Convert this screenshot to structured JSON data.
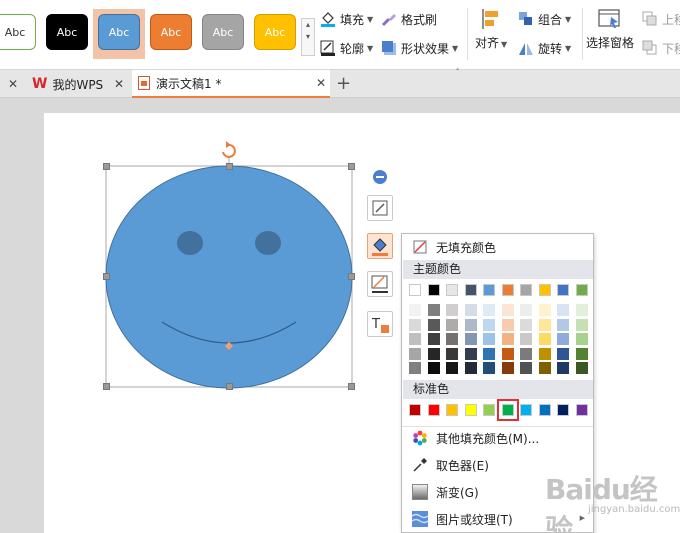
{
  "colors": {
    "shape_fill": "#5b9bd5",
    "shape_stroke": "#41719c",
    "accent": "#f07c3a",
    "highlight": "#e03030"
  },
  "ribbon": {
    "styles": [
      {
        "label": "Abc",
        "bg": "#ffffff",
        "fg": "#333333",
        "border": "#70ad47"
      },
      {
        "label": "Abc",
        "bg": "#000000",
        "fg": "#ffffff",
        "border": "#000000"
      },
      {
        "label": "Abc",
        "bg": "#5b9bd5",
        "fg": "#ffffff",
        "border": "#41719c"
      },
      {
        "label": "Abc",
        "bg": "#ed7d31",
        "fg": "#ffffff",
        "border": "#c05a18"
      },
      {
        "label": "Abc",
        "bg": "#a5a5a5",
        "fg": "#ffffff",
        "border": "#848484"
      },
      {
        "label": "Abc",
        "bg": "#ffc000",
        "fg": "#ffffff",
        "border": "#d49e00"
      }
    ],
    "fill": "填充",
    "format_brush": "格式刷",
    "outline": "轮廓",
    "shape_effects": "形状效果",
    "align": "对齐",
    "group": "组合",
    "rotate": "旋转",
    "selection_pane": "选择窗格",
    "move_up": "上移",
    "move_down": "下移"
  },
  "tabs": [
    {
      "label": "我的WPS",
      "logo": "W"
    },
    {
      "label": "演示文稿1 *"
    }
  ],
  "fill_menu": {
    "no_fill": "无填充颜色",
    "theme_colors_header": "主题颜色",
    "theme_colors": [
      "#ffffff",
      "#000000",
      "#e7e6e6",
      "#44546a",
      "#5b9bd5",
      "#ed7d31",
      "#a5a5a5",
      "#ffc000",
      "#4472c4",
      "#70ad47"
    ],
    "theme_tints": [
      [
        "#f2f2f2",
        "#7f7f7f",
        "#d0cece",
        "#d6dce5",
        "#deebf7",
        "#fbe5d6",
        "#ededed",
        "#fff2cc",
        "#dae3f3",
        "#e2f0d9"
      ],
      [
        "#d9d9d9",
        "#595959",
        "#aeabab",
        "#adb9ca",
        "#bdd7ee",
        "#f8cbad",
        "#dbdbdb",
        "#ffe699",
        "#b4c7e7",
        "#c5e0b4"
      ],
      [
        "#bfbfbf",
        "#404040",
        "#757171",
        "#8497b0",
        "#9dc3e6",
        "#f4b183",
        "#c9c9c9",
        "#ffd966",
        "#8faadc",
        "#a9d18e"
      ],
      [
        "#a6a6a6",
        "#262626",
        "#3b3838",
        "#333f50",
        "#2e75b6",
        "#c55a11",
        "#7b7b7b",
        "#bf9000",
        "#2f5597",
        "#548235"
      ],
      [
        "#808080",
        "#0d0d0d",
        "#171616",
        "#222a35",
        "#1f4e79",
        "#843c0c",
        "#525252",
        "#7f6000",
        "#203864",
        "#385723"
      ]
    ],
    "standard_header": "标准色",
    "standard_colors": [
      "#c00000",
      "#ff0000",
      "#ffc000",
      "#ffff00",
      "#92d050",
      "#00b050",
      "#00b0f0",
      "#0070c0",
      "#002060",
      "#7030a0"
    ],
    "selected_standard_index": 5,
    "more_colors": "其他填充颜色(M)...",
    "eyedropper": "取色器(E)",
    "gradient": "渐变(G)",
    "picture_texture": "图片或纹理(T)"
  },
  "watermark": {
    "text": "Baidu经验",
    "sub": "jingyan.baidu.com"
  }
}
